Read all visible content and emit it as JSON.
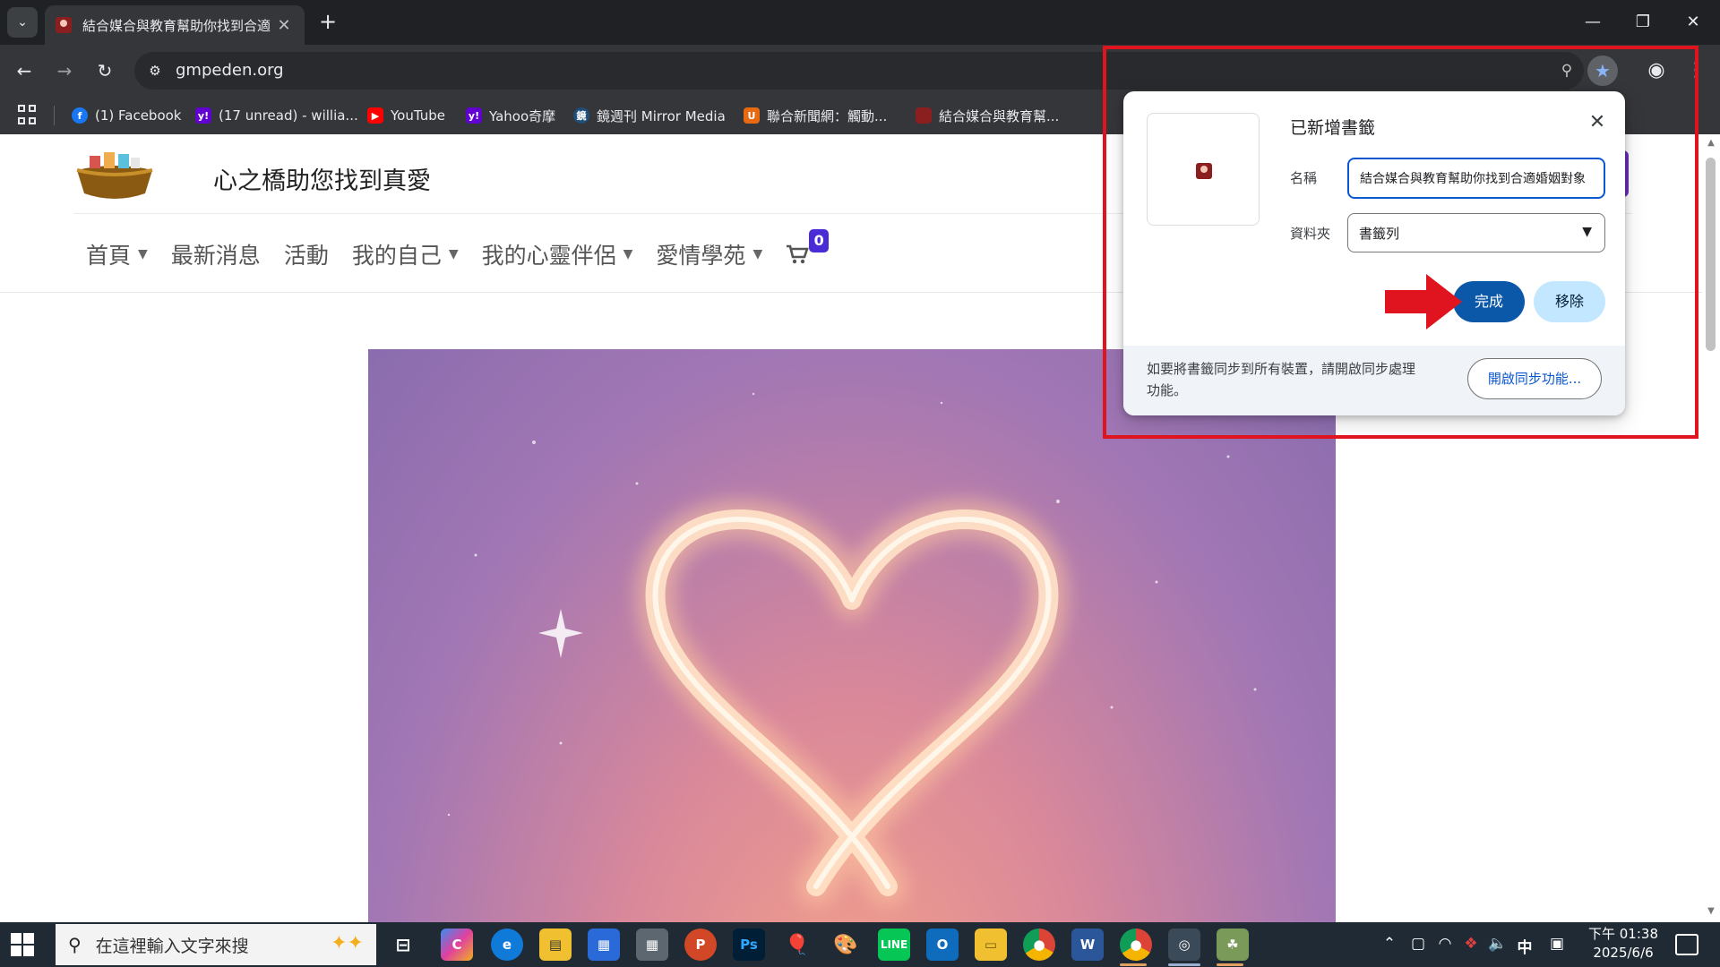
{
  "browser": {
    "tab_title": "結合媒合與教育幫助你找到合適",
    "url": "gmpeden.org",
    "bookmarks": [
      {
        "label": "(1) Facebook",
        "icon": "facebook-icon",
        "color": "#1877f2",
        "glyph": "f"
      },
      {
        "label": "(17 unread) - willia...",
        "icon": "yahoo-mail-icon",
        "color": "#6001d2",
        "glyph": "y!"
      },
      {
        "label": "YouTube",
        "icon": "youtube-icon",
        "color": "#ff0000",
        "glyph": "▶"
      },
      {
        "label": "Yahoo奇摩",
        "icon": "yahoo-icon",
        "color": "#6001d2",
        "glyph": "y!"
      },
      {
        "label": "鏡週刊 Mirror Media",
        "icon": "mirror-media-icon",
        "color": "#1f4e79",
        "glyph": "鏡"
      },
      {
        "label": "聯合新聞網：觸動...",
        "icon": "udn-icon",
        "color": "#e86a10",
        "glyph": "U"
      },
      {
        "label": "結合媒合與教育幫...",
        "icon": "site-favicon",
        "color": "#8b1f1f",
        "glyph": ""
      }
    ]
  },
  "site": {
    "title": "心之橋助您找到真愛",
    "menu": [
      {
        "label": "首頁",
        "dropdown": true
      },
      {
        "label": "最新消息",
        "dropdown": false
      },
      {
        "label": "活動",
        "dropdown": false
      },
      {
        "label": "我的自己",
        "dropdown": true
      },
      {
        "label": "我的心靈伴侶",
        "dropdown": true
      },
      {
        "label": "愛情學苑",
        "dropdown": true
      }
    ],
    "cart_count": "0"
  },
  "popup": {
    "title": "已新增書籤",
    "name_label": "名稱",
    "name_value": "結合媒合與教育幫助你找到合適婚姻對象",
    "folder_label": "資料夾",
    "folder_value": "書籤列",
    "done_label": "完成",
    "remove_label": "移除",
    "sync_text": "如要將書籤同步到所有裝置，請開啟同步處理功能。",
    "sync_button": "開啟同步功能..."
  },
  "taskbar": {
    "search_placeholder": "在這裡輸入文字來搜",
    "ime": "中",
    "time": "下午 01:38",
    "date": "2025/6/6"
  },
  "colors": {
    "accent_blue": "#0b57d0",
    "done_button": "#0b57a8",
    "highlight_red": "#e0141e",
    "cart_badge": "#4a2bd6"
  }
}
